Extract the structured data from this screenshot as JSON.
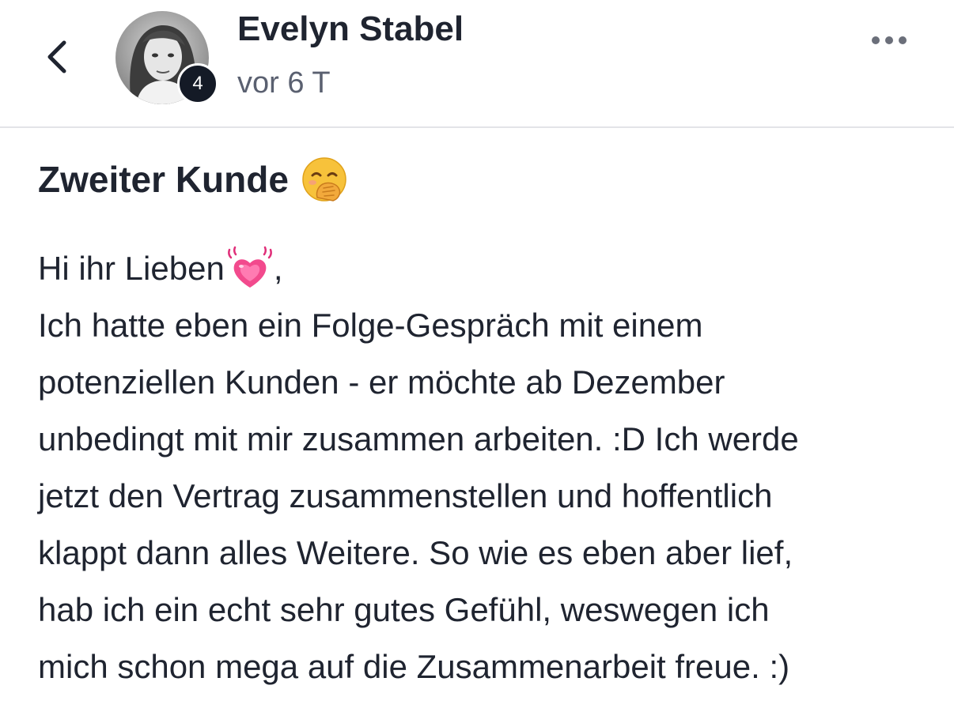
{
  "header": {
    "back_icon": "chevron-left-icon",
    "author_name": "Evelyn Stabel",
    "level_badge": "4",
    "time": "vor 6 T",
    "more_icon": "more-horizontal-icon"
  },
  "post": {
    "title": "Zweiter Kunde",
    "title_emoji": "face-with-hand-over-mouth",
    "greeting": "Hi ihr Lieben",
    "greeting_emoji": "beating-heart",
    "greeting_suffix": ",",
    "lines": [
      "Ich hatte eben ein Folge-Gespräch mit einem",
      "potenziellen Kunden - er möchte ab Dezember",
      "unbedingt mit mir zusammen arbeiten. :D Ich werde",
      "jetzt den Vertrag zusammenstellen und hoffentlich",
      "klappt dann alles Weitere. So wie es eben aber lief,",
      "hab ich ein echt sehr gutes Gefühl, weswegen ich",
      "mich schon mega auf die Zusammenarbeit freue. :)"
    ]
  },
  "colors": {
    "text": "#1f2430",
    "muted": "#5a6070",
    "badge": "#141a26",
    "divider": "#e3e4e8"
  }
}
